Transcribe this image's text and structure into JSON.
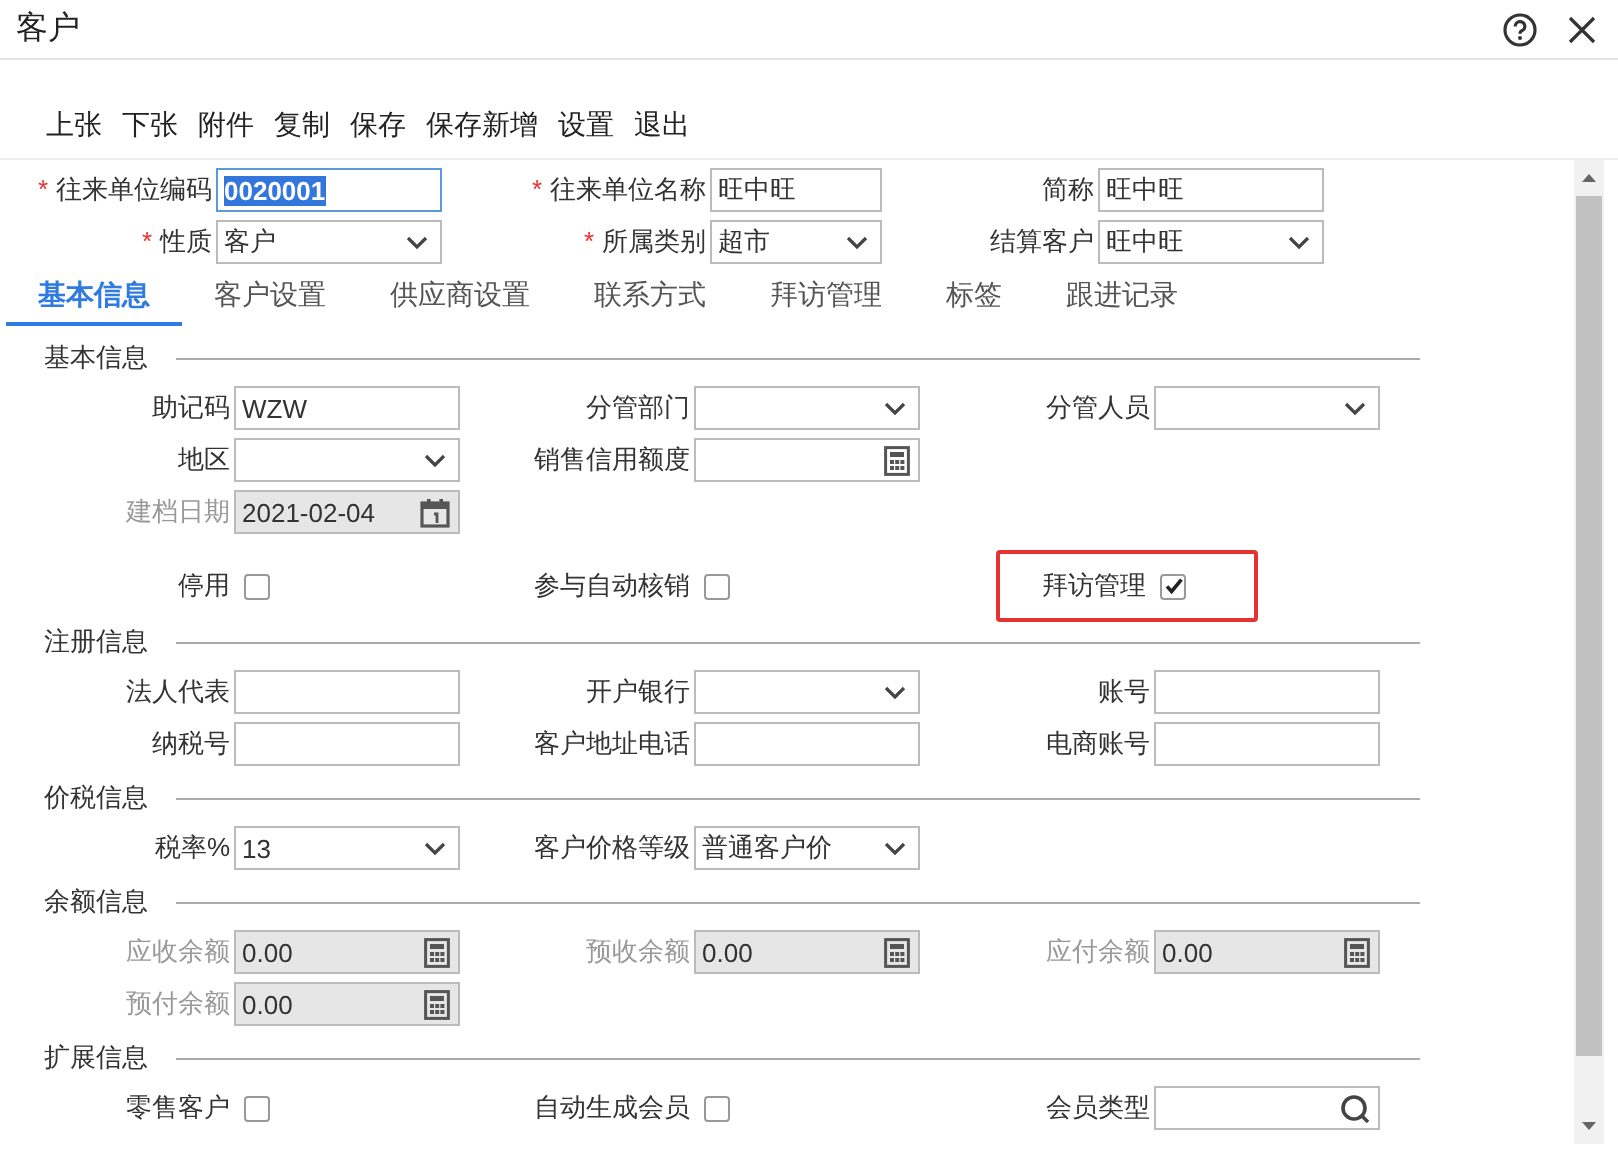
{
  "window": {
    "title": "客户"
  },
  "toolbar": [
    "上张",
    "下张",
    "附件",
    "复制",
    "保存",
    "保存新增",
    "设置",
    "退出"
  ],
  "header_fields": [
    {
      "label": "往来单位编码",
      "mark": "*",
      "kind": "text",
      "value": "0020001",
      "text_selected": true
    },
    {
      "label": "往来单位名称",
      "mark": "*",
      "kind": "text",
      "value": "旺中旺",
      "text_selected": false
    },
    {
      "label": "简称",
      "kind": "text",
      "value": "旺中旺",
      "text_selected": false
    },
    {
      "label": "性质",
      "mark": "*",
      "kind": "select",
      "value": "客户",
      "text_selected": false
    },
    {
      "label": "所属类别",
      "mark": "*",
      "kind": "select",
      "value": "超市",
      "text_selected": false
    },
    {
      "label": "结算客户",
      "kind": "select",
      "value": "旺中旺",
      "text_selected": false
    }
  ],
  "tabs": [
    {
      "label": "基本信息",
      "selected": true
    },
    {
      "label": "客户设置",
      "selected": false
    },
    {
      "label": "供应商设置",
      "selected": false
    },
    {
      "label": "联系方式",
      "selected": false
    },
    {
      "label": "拜访管理",
      "selected": false
    },
    {
      "label": "标签",
      "selected": false
    },
    {
      "label": "跟进记录",
      "selected": false
    }
  ],
  "sections": [
    {
      "title": "基本信息",
      "rows": [
        [
          {
            "label": "助记码",
            "kind": "text",
            "value": "WZW",
            "disabled": false
          },
          {
            "label": "分管部门",
            "kind": "select",
            "disabled": false
          },
          {
            "label": "分管人员",
            "kind": "select",
            "disabled": false
          }
        ],
        [
          {
            "label": "地区",
            "kind": "select",
            "disabled": false
          },
          {
            "label": "销售信用额度",
            "kind": "calc",
            "disabled": false
          }
        ],
        [
          {
            "label": "建档日期",
            "kind": "date",
            "value": "2021-02-04",
            "disabled": true
          }
        ],
        [
          {
            "label": "停用",
            "kind": "check",
            "checked": false,
            "highlighted": false,
            "disabled": false
          },
          {
            "label": "参与自动核销",
            "kind": "check",
            "checked": false,
            "highlighted": false,
            "disabled": false
          },
          {
            "label": "拜访管理",
            "kind": "check",
            "checked": true,
            "highlighted": true,
            "disabled": false
          }
        ]
      ]
    },
    {
      "title": "注册信息",
      "rows": [
        [
          {
            "label": "法人代表",
            "kind": "text",
            "disabled": false
          },
          {
            "label": "开户银行",
            "kind": "select",
            "disabled": false
          },
          {
            "label": "账号",
            "kind": "text",
            "disabled": false
          }
        ],
        [
          {
            "label": "纳税号",
            "kind": "text",
            "disabled": false
          },
          {
            "label": "客户地址电话",
            "kind": "text",
            "disabled": false
          },
          {
            "label": "电商账号",
            "kind": "text",
            "disabled": false
          }
        ]
      ]
    },
    {
      "title": "价税信息",
      "rows": [
        [
          {
            "label": "税率%",
            "kind": "select",
            "value": "13",
            "disabled": false
          },
          {
            "label": "客户价格等级",
            "kind": "select",
            "value": "普通客户价",
            "disabled": false
          }
        ]
      ]
    },
    {
      "title": "余额信息",
      "rows": [
        [
          {
            "label": "应收余额",
            "kind": "calc",
            "value": "0.00",
            "disabled": true
          },
          {
            "label": "预收余额",
            "kind": "calc",
            "value": "0.00",
            "disabled": true
          },
          {
            "label": "应付余额",
            "kind": "calc",
            "value": "0.00",
            "disabled": true
          }
        ],
        [
          {
            "label": "预付余额",
            "kind": "calc",
            "value": "0.00",
            "disabled": true
          }
        ]
      ]
    },
    {
      "title": "扩展信息",
      "rows": [
        [
          {
            "label": "零售客户",
            "kind": "check",
            "checked": false,
            "highlighted": false,
            "disabled": false
          },
          {
            "label": "自动生成会员",
            "kind": "check",
            "checked": false,
            "highlighted": false,
            "disabled": false
          },
          {
            "label": "会员类型",
            "kind": "lookup",
            "disabled": false
          }
        ]
      ]
    }
  ]
}
